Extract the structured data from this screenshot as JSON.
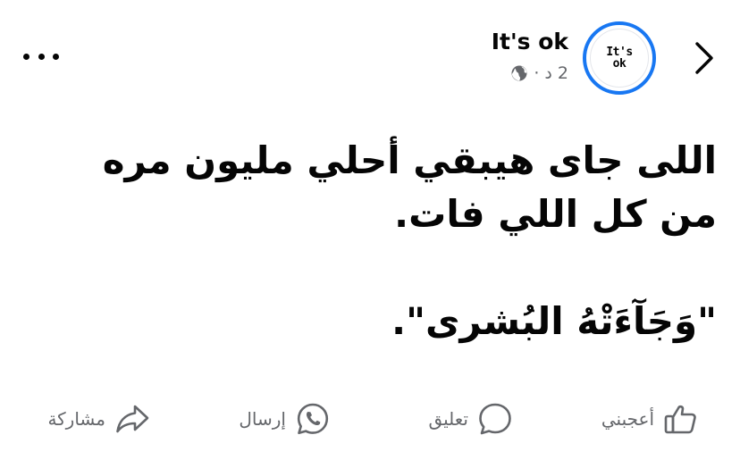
{
  "post": {
    "author": "It's ok",
    "avatar": {
      "line1": "It's",
      "line2": "ok"
    },
    "time": "2 د",
    "separator": "·",
    "audience_icon": "globe-icon",
    "paragraphs": [
      "اللى جاى هيبقي أحلي مليون مره من كل اللي فات.",
      "\"وَجَآءَتْهُ البُشرى\"."
    ]
  },
  "actions": {
    "like": "أعجبني",
    "comment": "تعليق",
    "send": "إرسال",
    "share": "مشاركة"
  },
  "colors": {
    "accent": "#1877f2",
    "text": "#050505",
    "secondary": "#65676b"
  }
}
